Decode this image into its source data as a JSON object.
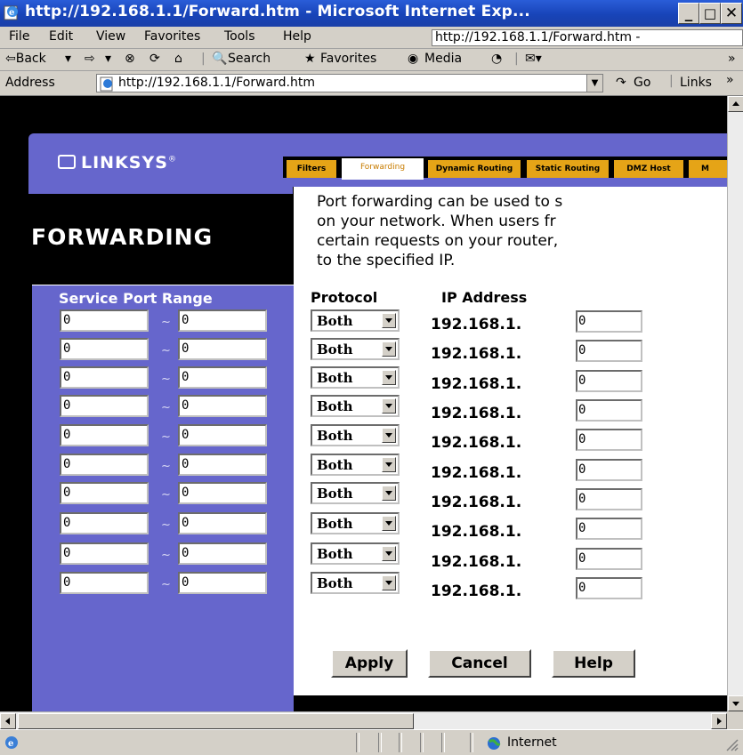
{
  "window": {
    "title": "http://192.168.1.1/Forward.htm - Microsoft Internet Exp...",
    "controls": {
      "minimize": "_",
      "maximize": "□",
      "close": "✕"
    }
  },
  "menu": {
    "items": [
      "File",
      "Edit",
      "View",
      "Favorites",
      "Tools",
      "Help"
    ],
    "url_display": "http://192.168.1.1/Forward.htm -"
  },
  "toolbar": {
    "back": "⇦Back",
    "search": "Search",
    "favorites": "Favorites",
    "media": "Media"
  },
  "address": {
    "label": "Address",
    "value": "http://192.168.1.1/Forward.htm",
    "go": "Go",
    "links": "Links"
  },
  "page": {
    "brand": "LINKSYS",
    "brand_mark": "®",
    "tabs": [
      "Filters",
      "Forwarding",
      "Dynamic Routing",
      "Static Routing",
      "DMZ Host",
      "M"
    ],
    "active_tab": "Forwarding",
    "heading": "FORWARDING",
    "description": "Port forwarding can be used to s\non your network. When users fr\ncertain requests on your router,\nto the specified IP.",
    "columns": {
      "service_port_range": "Service Port Range",
      "protocol": "Protocol",
      "ip_address": "IP Address"
    },
    "tilde": "~",
    "ip_prefix": "192.168.1.",
    "rows": [
      {
        "start": "0",
        "end": "0",
        "protocol": "Both",
        "ip": "0"
      },
      {
        "start": "0",
        "end": "0",
        "protocol": "Both",
        "ip": "0"
      },
      {
        "start": "0",
        "end": "0",
        "protocol": "Both",
        "ip": "0"
      },
      {
        "start": "0",
        "end": "0",
        "protocol": "Both",
        "ip": "0"
      },
      {
        "start": "0",
        "end": "0",
        "protocol": "Both",
        "ip": "0"
      },
      {
        "start": "0",
        "end": "0",
        "protocol": "Both",
        "ip": "0"
      },
      {
        "start": "0",
        "end": "0",
        "protocol": "Both",
        "ip": "0"
      },
      {
        "start": "0",
        "end": "0",
        "protocol": "Both",
        "ip": "0"
      },
      {
        "start": "0",
        "end": "0",
        "protocol": "Both",
        "ip": "0"
      },
      {
        "start": "0",
        "end": "0",
        "protocol": "Both",
        "ip": "0"
      }
    ],
    "buttons": {
      "apply": "Apply",
      "cancel": "Cancel",
      "help": "Help"
    }
  },
  "status": {
    "zone": "Internet"
  },
  "colors": {
    "panel": "#6666cc",
    "tab": "#e5a417",
    "titlebar": "#1844b8"
  }
}
